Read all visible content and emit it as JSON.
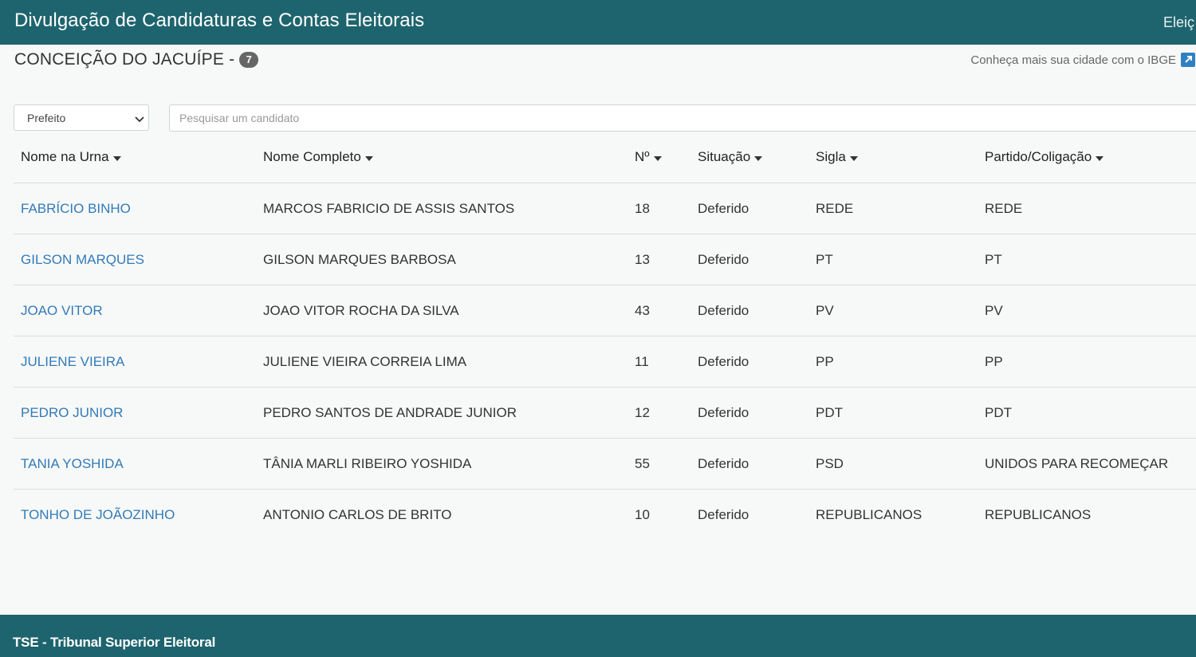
{
  "header": {
    "title": "Divulgação de Candidaturas e Contas Eleitorais",
    "right_text": "Eleiç"
  },
  "city": {
    "name": "CONCEIÇÃO DO JACUÍPE -",
    "count": "7",
    "ibge_link": "Conheça mais sua cidade com o IBGE",
    "ibge_icon": "external-link-icon"
  },
  "filters": {
    "office_selected": "Prefeito",
    "search_placeholder": "Pesquisar um candidato"
  },
  "table": {
    "columns": [
      "Nome na Urna",
      "Nome Completo",
      "Nº",
      "Situação",
      "Sigla",
      "Partido/Coligação"
    ],
    "rows": [
      [
        "FABRÍCIO BINHO",
        "MARCOS FABRICIO DE ASSIS SANTOS",
        "18",
        "Deferido",
        "REDE",
        "REDE"
      ],
      [
        "GILSON MARQUES",
        "GILSON MARQUES BARBOSA",
        "13",
        "Deferido",
        "PT",
        "PT"
      ],
      [
        "JOAO VITOR",
        "JOAO VITOR ROCHA DA SILVA",
        "43",
        "Deferido",
        "PV",
        "PV"
      ],
      [
        "JULIENE VIEIRA",
        "JULIENE VIEIRA CORREIA LIMA",
        "11",
        "Deferido",
        "PP",
        "PP"
      ],
      [
        "PEDRO JUNIOR",
        "PEDRO SANTOS DE ANDRADE JUNIOR",
        "12",
        "Deferido",
        "PDT",
        "PDT"
      ],
      [
        "TANIA YOSHIDA",
        "TÂNIA MARLI RIBEIRO YOSHIDA",
        "55",
        "Deferido",
        "PSD",
        "UNIDOS PARA RECOMEÇAR"
      ],
      [
        "TONHO DE JOÃOZINHO",
        "ANTONIO CARLOS DE BRITO",
        "10",
        "Deferido",
        "REPUBLICANOS",
        "REPUBLICANOS"
      ]
    ]
  },
  "footer": {
    "text": "TSE - Tribunal Superior Eleitoral"
  },
  "colors": {
    "brand": "#1e646e",
    "link": "#337ab7",
    "badge": "#666666"
  }
}
